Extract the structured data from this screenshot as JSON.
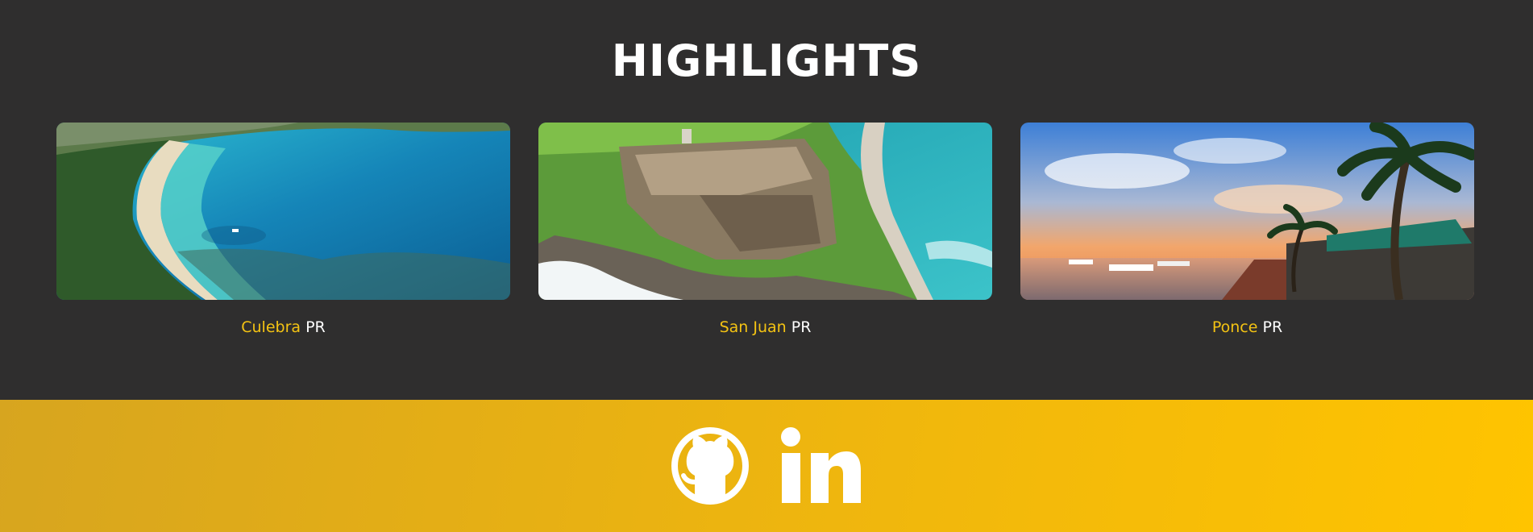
{
  "highlights": {
    "title": "HIGHLIGHTS",
    "cards": [
      {
        "city": "Culebra",
        "suffix": "PR",
        "image": "culebra-beach-aerial"
      },
      {
        "city": "San Juan",
        "suffix": "PR",
        "image": "el-morro-fort-aerial"
      },
      {
        "city": "Ponce",
        "suffix": "PR",
        "image": "ponce-sunset-marina"
      }
    ]
  },
  "footer": {
    "links": [
      {
        "icon": "github-icon"
      },
      {
        "icon": "linkedin-icon"
      }
    ]
  },
  "colors": {
    "background": "#2f2e2e",
    "accent": "#f4c313",
    "footer_gradient_start": "#d7a51f",
    "footer_gradient_end": "#ffc400"
  }
}
